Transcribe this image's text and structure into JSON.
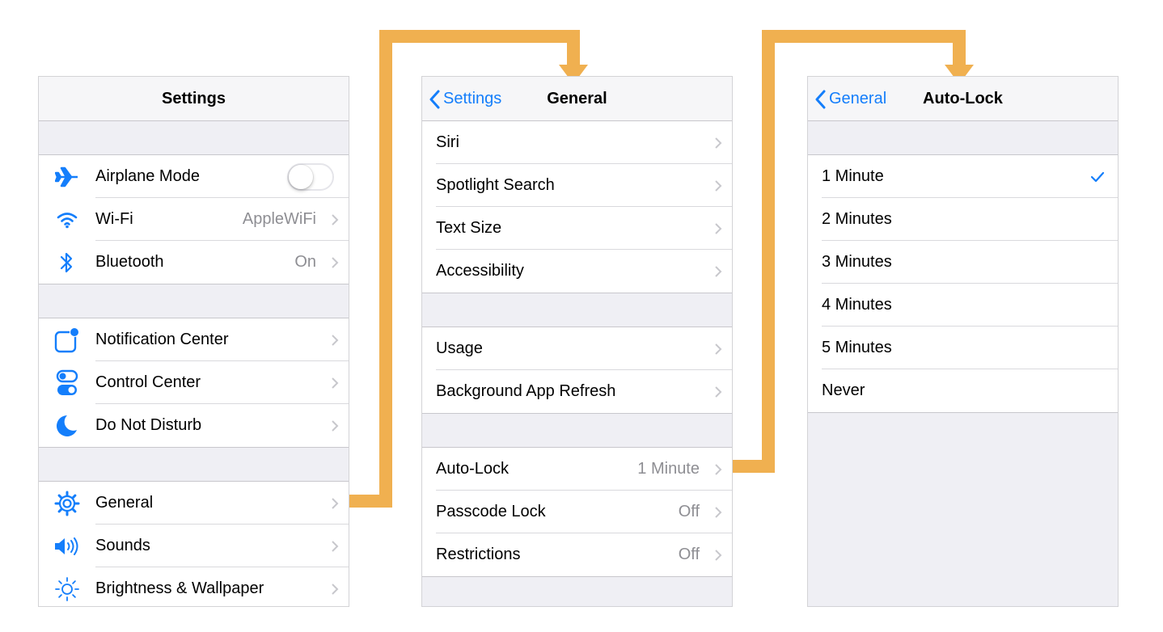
{
  "colors": {
    "accent": "#147efb",
    "connector": "#f0b050",
    "chevron": "#c7c7cc"
  },
  "settings": {
    "title": "Settings",
    "group1": [
      {
        "label": "Airplane Mode",
        "icon": "airplane-icon",
        "toggle": "off"
      },
      {
        "label": "Wi-Fi",
        "value": "AppleWiFi",
        "icon": "wifi-icon"
      },
      {
        "label": "Bluetooth",
        "value": "On",
        "icon": "bluetooth-icon"
      }
    ],
    "group2": [
      {
        "label": "Notification Center",
        "icon": "notification-center-icon"
      },
      {
        "label": "Control Center",
        "icon": "control-center-icon"
      },
      {
        "label": "Do Not Disturb",
        "icon": "moon-icon"
      }
    ],
    "group3": [
      {
        "label": "General",
        "icon": "gear-icon"
      },
      {
        "label": "Sounds",
        "icon": "speaker-icon"
      },
      {
        "label": "Brightness & Wallpaper",
        "icon": "brightness-icon"
      }
    ]
  },
  "general": {
    "title": "General",
    "back_label": "Settings",
    "group1": [
      {
        "label": "Siri"
      },
      {
        "label": "Spotlight Search"
      },
      {
        "label": "Text Size"
      },
      {
        "label": "Accessibility"
      }
    ],
    "group2": [
      {
        "label": "Usage"
      },
      {
        "label": "Background App Refresh"
      }
    ],
    "group3": [
      {
        "label": "Auto-Lock",
        "value": "1 Minute"
      },
      {
        "label": "Passcode Lock",
        "value": "Off"
      },
      {
        "label": "Restrictions",
        "value": "Off"
      }
    ]
  },
  "autolock": {
    "title": "Auto-Lock",
    "back_label": "General",
    "options": [
      {
        "label": "1 Minute",
        "selected": true
      },
      {
        "label": "2 Minutes"
      },
      {
        "label": "3 Minutes"
      },
      {
        "label": "4 Minutes"
      },
      {
        "label": "5 Minutes"
      },
      {
        "label": "Never"
      }
    ]
  }
}
